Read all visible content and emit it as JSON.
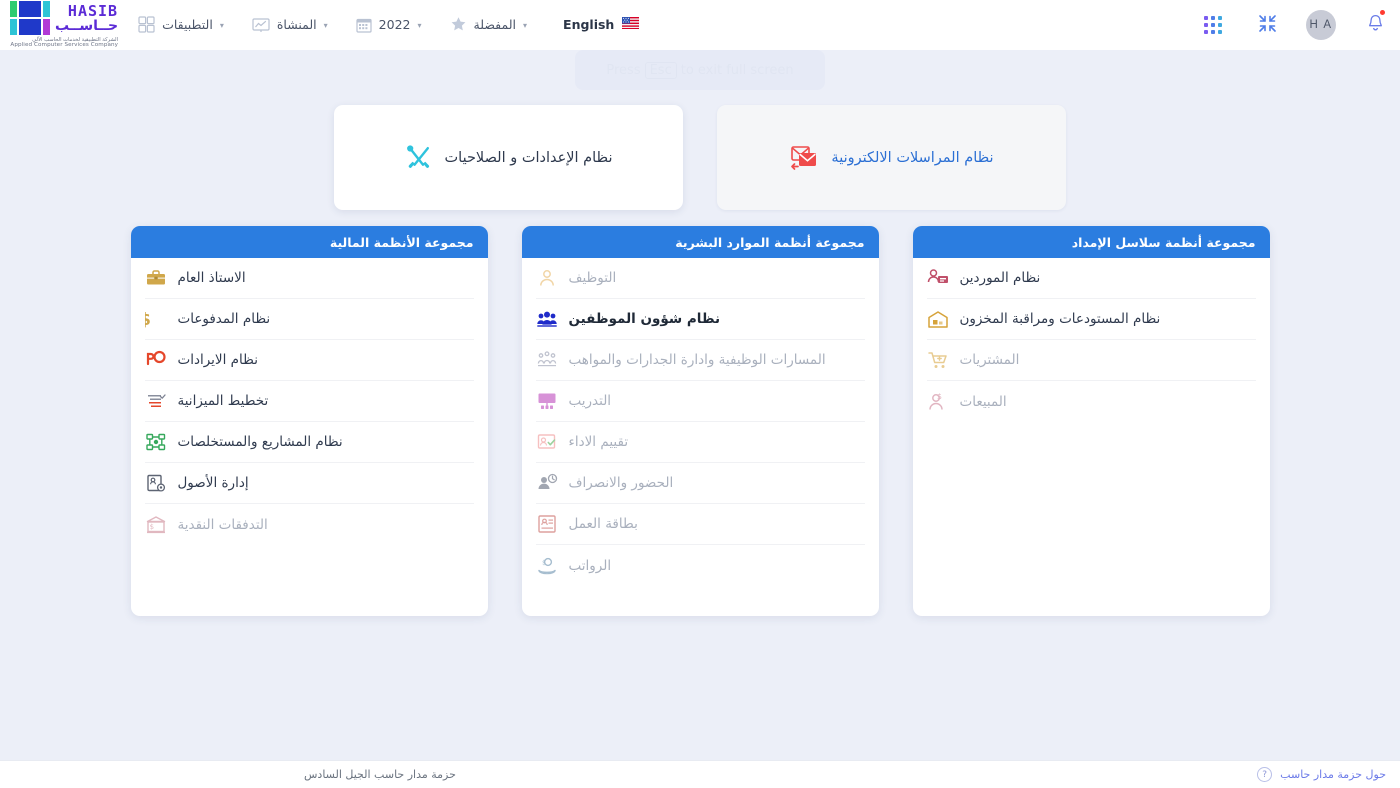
{
  "topbar": {
    "apps_grid_icon": "grid-apps-icon",
    "collapse_icon": "collapse-fullscreen-icon",
    "avatar_initials": "H A",
    "notifications_icon": "bell-icon",
    "menus": [
      {
        "label": "التطبيقات",
        "icon": "apps-grid-icon"
      },
      {
        "label": "المنشاة",
        "icon": "organization-chart-icon"
      },
      {
        "label": "2022",
        "icon": "calendar-icon"
      },
      {
        "label": "المفضلة",
        "icon": "star-icon"
      }
    ],
    "language": {
      "label": "English",
      "flag": "us-flag-icon"
    },
    "logo": {
      "latin": "HASIB",
      "arabic": "حــاســب",
      "sub_arabic": "الشركة التطبيقية لخدمات الحاسب الآلي",
      "sub_english": "Applied Computer Services Company"
    }
  },
  "fullscreen_hint": {
    "prefix": "Press",
    "key": "Esc",
    "suffix": "to exit full screen"
  },
  "top_cards": [
    {
      "label": "نظام الإعدادات و الصلاحيات",
      "icon": "tools-wrench-screwdriver-icon",
      "style": "bright"
    },
    {
      "label": "نظام المراسلات الالكترونية",
      "icon": "mail-envelope-icon",
      "style": "muted"
    }
  ],
  "modules": [
    {
      "title": "مجموعة الأنظمة المالية",
      "items": [
        {
          "label": "الاستاذ العام",
          "icon": "briefcase-icon",
          "state": "enabled"
        },
        {
          "label": "نظام المدفوعات",
          "icon": "dollar-sign-icon",
          "state": "enabled"
        },
        {
          "label": "نظام الايرادات",
          "icon": "revenue-tag-icon",
          "state": "enabled"
        },
        {
          "label": "تخطيط الميزانية",
          "icon": "budget-list-icon",
          "state": "enabled"
        },
        {
          "label": "نظام المشاريع والمستخلصات",
          "icon": "projects-network-icon",
          "state": "enabled"
        },
        {
          "label": "إدارة الأصول",
          "icon": "assets-card-icon",
          "state": "enabled"
        },
        {
          "label": "التدفقات النقدية",
          "icon": "bank-cashflow-icon",
          "state": "disabled"
        }
      ]
    },
    {
      "title": "مجموعة أنظمة الموارد البشرية",
      "items": [
        {
          "label": "التوظيف",
          "icon": "person-hire-icon",
          "state": "disabled"
        },
        {
          "label": "نظام شؤون الموظفين",
          "icon": "employees-group-icon",
          "state": "active"
        },
        {
          "label": "المسارات الوظيفية وادارة الجدارات والمواهب",
          "icon": "career-path-icon",
          "state": "disabled"
        },
        {
          "label": "التدريب",
          "icon": "training-board-icon",
          "state": "disabled"
        },
        {
          "label": "تقييم الاداء",
          "icon": "performance-review-icon",
          "state": "disabled"
        },
        {
          "label": "الحضور والانصراف",
          "icon": "attendance-clock-icon",
          "state": "disabled"
        },
        {
          "label": "بطاقة العمل",
          "icon": "work-card-icon",
          "state": "disabled"
        },
        {
          "label": "الرواتب",
          "icon": "payroll-icon",
          "state": "disabled"
        }
      ]
    },
    {
      "title": "مجموعة أنظمة سلاسل الإمداد",
      "items": [
        {
          "label": "نظام الموردين",
          "icon": "suppliers-icon",
          "state": "enabled"
        },
        {
          "label": "نظام المستودعات ومراقبة المخزون",
          "icon": "warehouse-icon",
          "state": "enabled"
        },
        {
          "label": "المشتريات",
          "icon": "shopping-cart-icon",
          "state": "disabled"
        },
        {
          "label": "المبيعات",
          "icon": "sales-person-icon",
          "state": "disabled"
        }
      ]
    }
  ],
  "footer": {
    "about_link": "حول حزمة مدار حاسب",
    "help_icon": "question-mark-icon",
    "product": "حزمة مدار حاسب الجيل السادس"
  },
  "colors": {
    "background": "#eceff8",
    "card_header_blue": "#2b7de0",
    "link_blue": "#2b6fd4",
    "footer_link": "#6b7ae8",
    "logo_purple": "#5b2bd6",
    "notification_dot": "#ff3b30"
  }
}
